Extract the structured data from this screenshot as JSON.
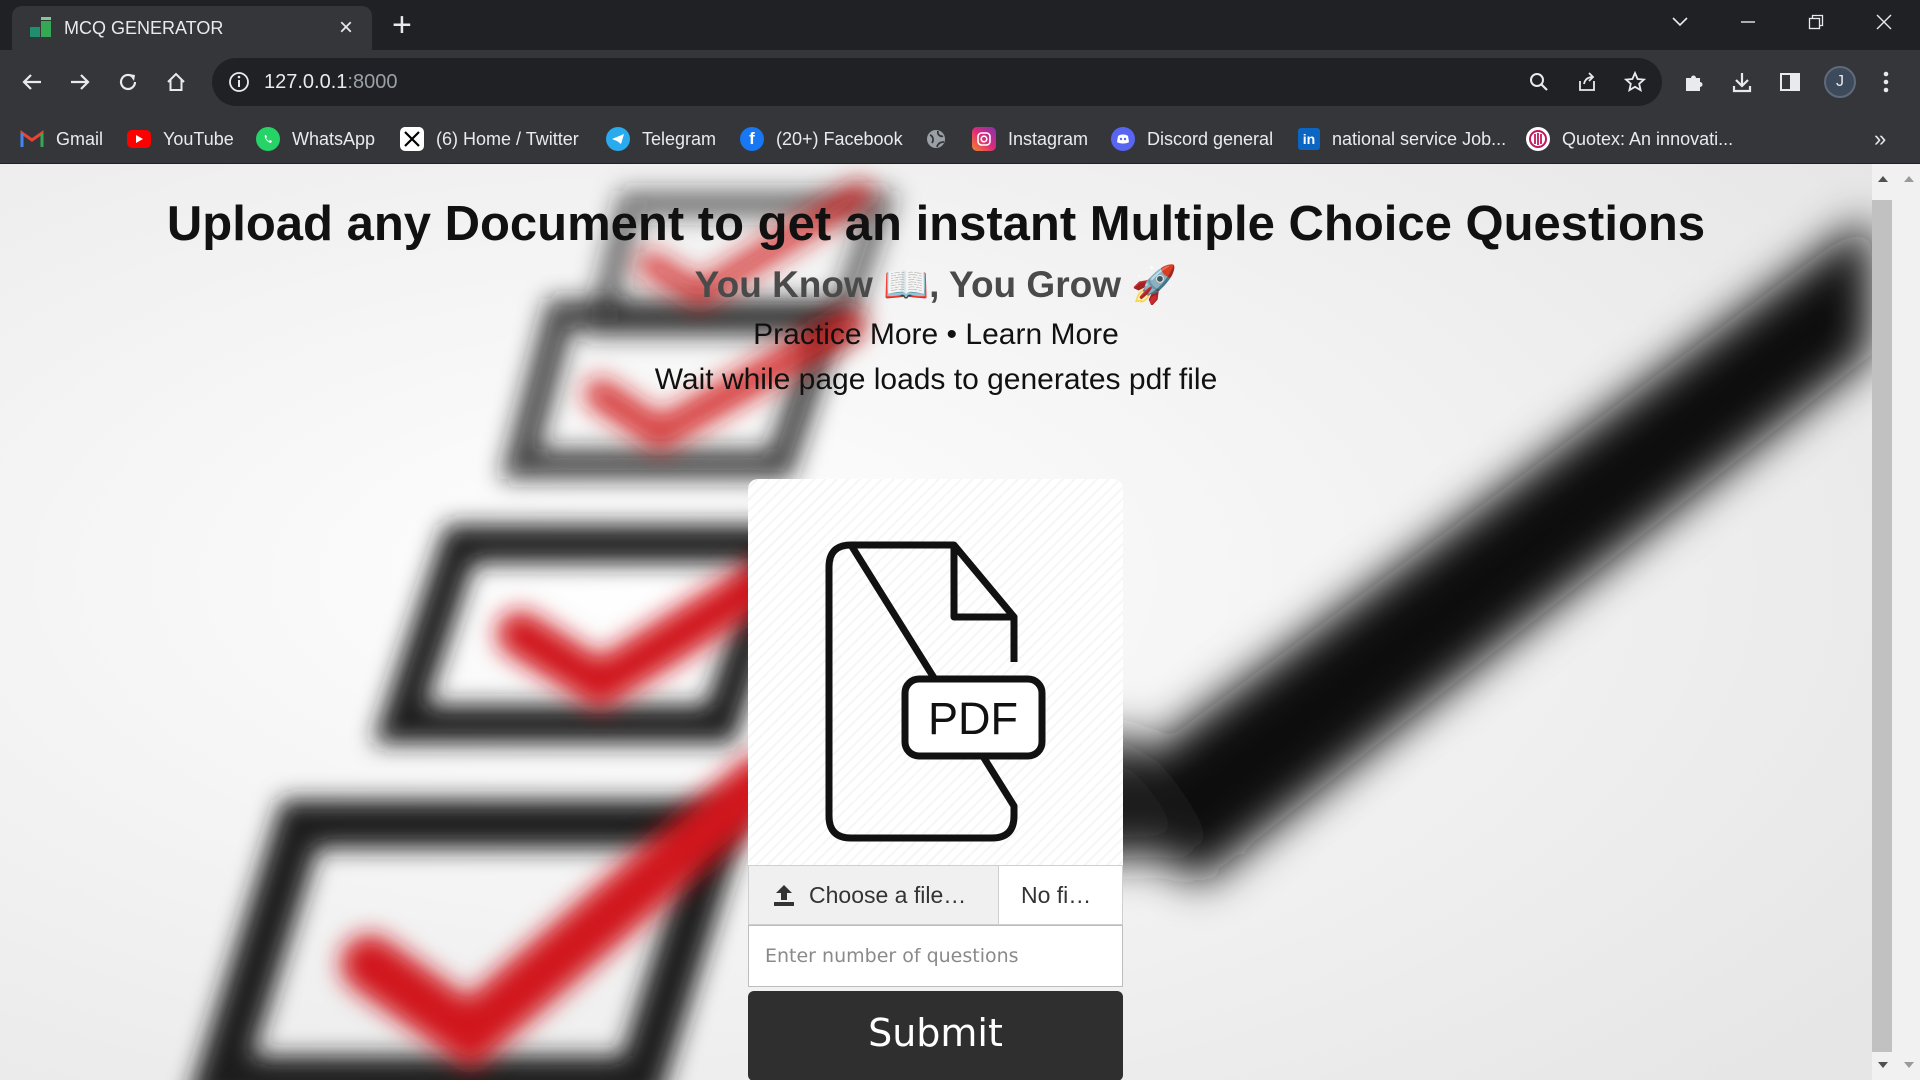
{
  "browser": {
    "tab": {
      "title": "MCQ GENERATOR",
      "icon": "mcq-generator-favicon"
    },
    "url": {
      "host": "127.0.0.1",
      "port": ":8000"
    },
    "profile_initial": "J",
    "bookmarks": [
      {
        "label": "Gmail",
        "icon": "gmail-icon",
        "color": "#ea4335"
      },
      {
        "label": "YouTube",
        "icon": "youtube-icon",
        "color": "#ff0000"
      },
      {
        "label": "WhatsApp",
        "icon": "whatsapp-icon",
        "color": "#25d366"
      },
      {
        "label": "(6) Home / Twitter",
        "icon": "x-twitter-icon",
        "color": "#000000"
      },
      {
        "label": "Telegram",
        "icon": "telegram-icon",
        "color": "#2aabee"
      },
      {
        "label": "(20+) Facebook",
        "icon": "facebook-icon",
        "color": "#1877f2"
      },
      {
        "label": "",
        "icon": "globe-icon",
        "color": "#9aa0a6"
      },
      {
        "label": "Instagram",
        "icon": "instagram-icon",
        "color": "#e1306c"
      },
      {
        "label": "Discord general",
        "icon": "discord-icon",
        "color": "#5865f2"
      },
      {
        "label": "national service Job...",
        "icon": "linkedin-icon",
        "color": "#0a66c2"
      },
      {
        "label": "Quotex: An innovati...",
        "icon": "quotex-icon",
        "color": "#c2185b"
      }
    ]
  },
  "page": {
    "heading": "Upload any Document to get an instant Multiple Choice Questions",
    "tagline": "You Know 📖, You Grow 🚀",
    "subtitle": "Practice More • Learn More",
    "notice": "Wait while page loads to generates pdf file",
    "form": {
      "pdf_label": "PDF",
      "choose_file_label": "Choose a file…",
      "no_file_label": "No fi…",
      "questions_placeholder": "Enter number of questions",
      "submit_label": "Submit"
    }
  }
}
